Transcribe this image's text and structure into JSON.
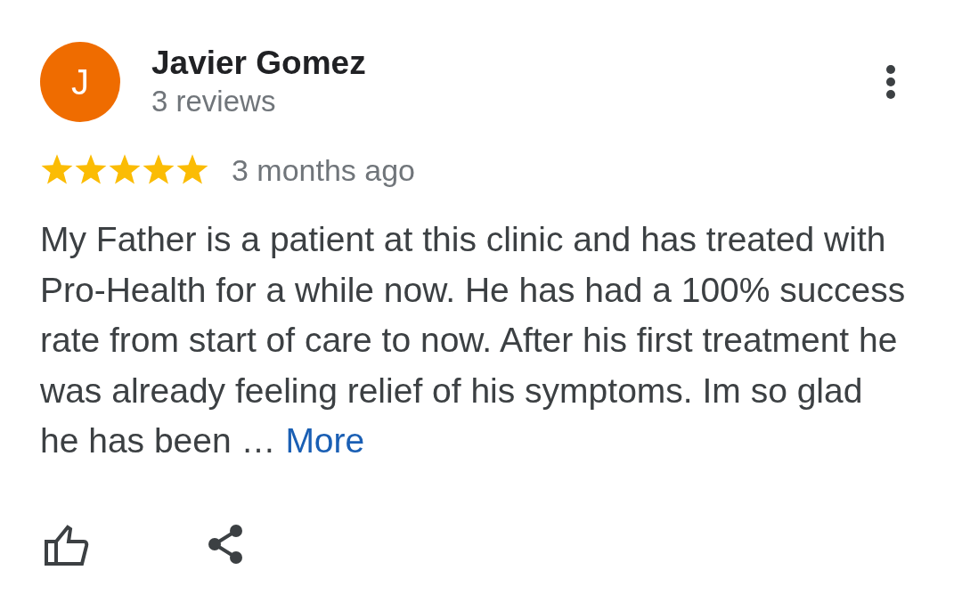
{
  "reviewer": {
    "initial": "J",
    "name": "Javier Gomez",
    "review_count": "3 reviews"
  },
  "rating": {
    "stars": 5,
    "time": "3 months ago"
  },
  "review": {
    "text": "My Father is a patient at this clinic and has treated with Pro-Health for a while now. He has had a 100% success rate from start of care to now. After his first treatment he was already feeling relief of his symptoms. Im so glad he has been …",
    "more_link": "More"
  }
}
